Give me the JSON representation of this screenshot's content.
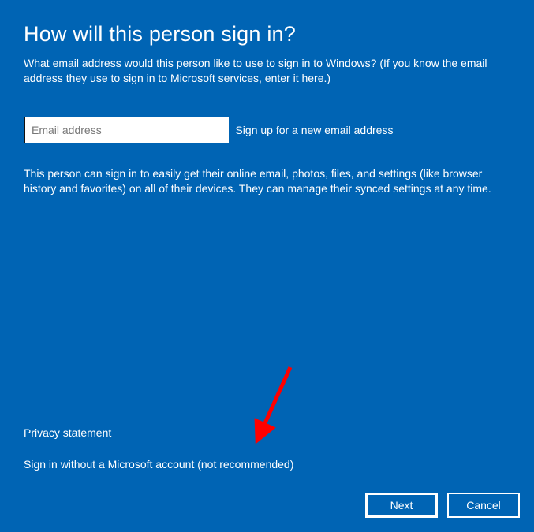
{
  "heading": "How will this person sign in?",
  "intro": "What email address would this person like to use to sign in to Windows? (If you know the email address they use to sign in to Microsoft services, enter it here.)",
  "email": {
    "placeholder": "Email address",
    "value": ""
  },
  "signup_link": "Sign up for a new email address",
  "benefit": "This person can sign in to easily get their online email, photos, files, and settings (like browser history and favorites) on all of their devices. They can manage their synced settings at any time.",
  "links": {
    "privacy": "Privacy statement",
    "no_msft": "Sign in without a Microsoft account (not recommended)"
  },
  "buttons": {
    "next": "Next",
    "cancel": "Cancel"
  },
  "colors": {
    "background": "#0064b4",
    "text": "#ffffff",
    "arrow": "#ff0000"
  }
}
